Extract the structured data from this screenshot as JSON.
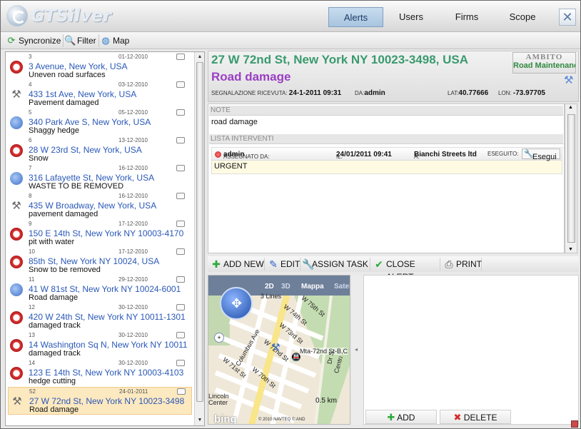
{
  "app": {
    "title": "GTSilver"
  },
  "nav": {
    "alerts": "Alerts",
    "users": "Users",
    "firms": "Firms",
    "scope": "Scope",
    "close": "✕"
  },
  "toolbar": {
    "sync": "Syncronize",
    "filter": "Filter",
    "map": "Map"
  },
  "alerts": [
    {
      "num": "3",
      "date": "01-12-2010",
      "address": "3 Avenue, New York, USA",
      "desc": "Uneven road surfaces",
      "icon": "alarm-icon"
    },
    {
      "num": "4",
      "date": "03-12-2010",
      "address": "433 1st Ave, New York, USA",
      "desc": "Pavement damaged",
      "icon": "tools-icon"
    },
    {
      "num": "5",
      "date": "05-12-2010",
      "address": "340 Park Ave S, New York, USA",
      "desc": "Shaggy hedge",
      "icon": "route-icon"
    },
    {
      "num": "6",
      "date": "13-12-2010",
      "address": "28 W 23rd St, New York, USA",
      "desc": "Snow",
      "icon": "alarm-icon"
    },
    {
      "num": "7",
      "date": "16-12-2010",
      "address": "316 Lafayette St, New York, USA",
      "desc": "WASTE TO BE REMOVED",
      "icon": "route-icon"
    },
    {
      "num": "8",
      "date": "16-12-2010",
      "address": "435 W Broadway, New York, USA",
      "desc": "pavement damaged",
      "icon": "tools-icon"
    },
    {
      "num": "9",
      "date": "17-12-2010",
      "address": "150 E 14th St, New York NY 10003-4170",
      "desc": "pit with water",
      "icon": "alarm-icon"
    },
    {
      "num": "10",
      "date": "17-12-2010",
      "address": "85th St, New York NY 10024, USA",
      "desc": "Snow to be removed",
      "icon": "alarm-icon"
    },
    {
      "num": "11",
      "date": "29-12-2010",
      "address": "41 W 81st St, New York NY 10024-6001",
      "desc": "Road damage",
      "icon": "route-icon"
    },
    {
      "num": "12",
      "date": "30-12-2010",
      "address": "420 W 24th St, New York NY 10011-1301",
      "desc": "damaged track",
      "icon": "alarm-icon"
    },
    {
      "num": "13",
      "date": "30-12-2010",
      "address": "14 Washington Sq N, New York NY 10011",
      "desc": "damaged track",
      "icon": "alarm-icon"
    },
    {
      "num": "14",
      "date": "30-12-2010",
      "address": "123 E 14th St, New York NY 10003-4103",
      "desc": "hedge cutting",
      "icon": "alarm-icon"
    },
    {
      "num": "52",
      "date": "24-01-2011",
      "address": "27 W 72nd St, New York NY 10023-3498",
      "desc": "Road damage",
      "icon": "tools-icon"
    }
  ],
  "detail": {
    "address": "27 W 72nd St, New York NY 10023-3498, USA",
    "title": "Road damage",
    "received_label": "SEGNALAZIONE RICEVUTA:",
    "received_value": "24-1-2011 09:31",
    "by_label": "DA:",
    "by_value": "admin",
    "lat_label": "LAT:",
    "lat_value": "40.77666",
    "lon_label": "LON:",
    "lon_value": "-73.97705",
    "ambito_label": "AMBITO",
    "ambito_value": "Road Maintenance"
  },
  "notes": {
    "header": "NOTE",
    "text": "road damage",
    "interventions_header": "LISTA INTERVENTI",
    "assigned_label": "ASSEGNATO DA:",
    "assigned_value": "admin",
    "il_label": "IL:",
    "il_value": "24/01/2011 09:41",
    "a_label": "A:",
    "a_value": "Bianchi Streets ltd",
    "eseguito_label": "ESEGUITO:",
    "esegui_button": "Esegui",
    "urgent": "URGENT"
  },
  "actions": {
    "add_new": "ADD NEW",
    "edit": "EDIT",
    "assign_task": "ASSIGN TASK",
    "close_alert": "CLOSE ALERT",
    "print": "PRINT"
  },
  "map": {
    "mode_2d": "2D",
    "mode_3d": "3D",
    "mode_road": "Mappa",
    "mode_sat": "Satellite",
    "streets": [
      "3 Lines",
      "W 75th St",
      "W 74th St",
      "W 73rd St",
      "W 72nd St",
      "W 71st St",
      "W 70th St",
      "Columbus Ave",
      "Mta-72nd St-B,C",
      "Central Park West",
      "Dr S",
      "Lincoln Center"
    ],
    "scale": "0.5 km",
    "copyright": "© 2010 NAVTEQ © AND",
    "brand": "bing"
  },
  "pane": {
    "add": "ADD",
    "delete": "DELETE"
  },
  "colors": {
    "address_green": "#3a9a6e",
    "title_purple": "#9a3fc4",
    "link_blue": "#2a58b8",
    "nav_active": "#a8c4df"
  }
}
